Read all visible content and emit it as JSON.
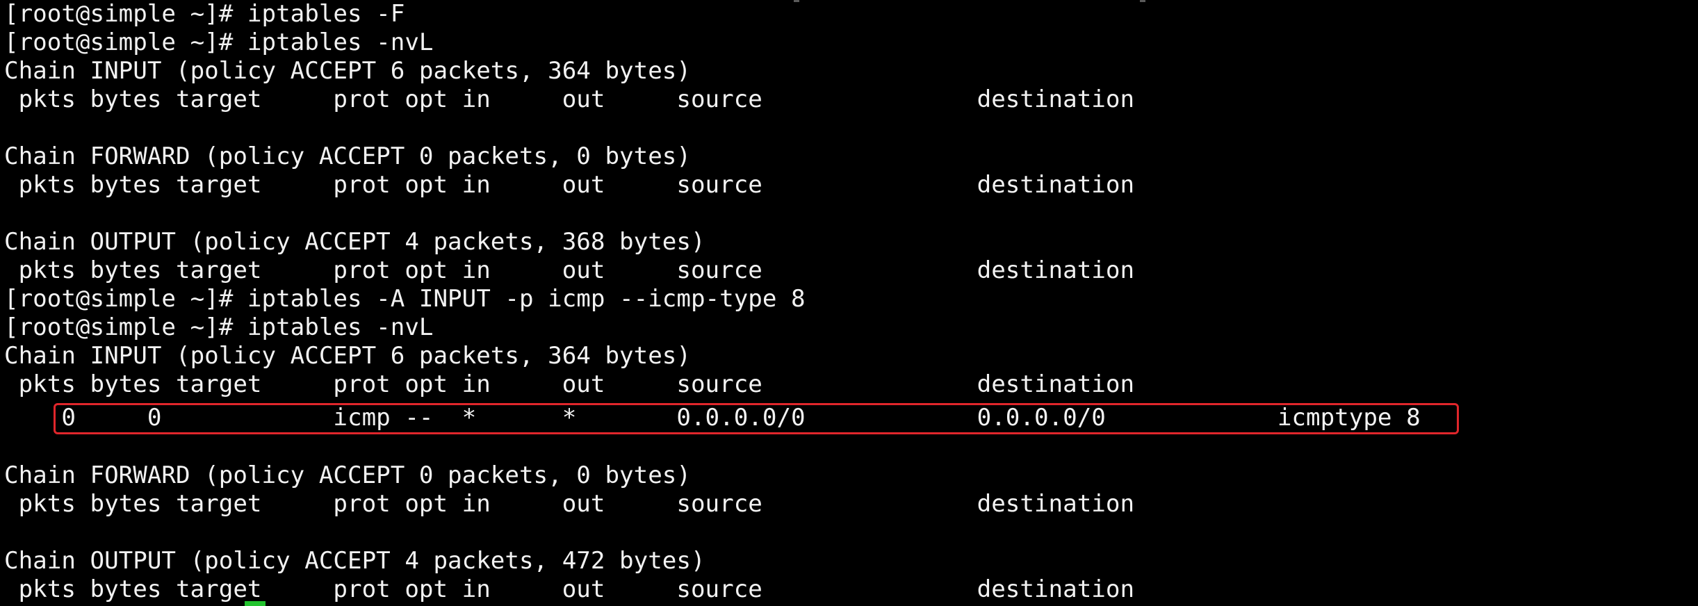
{
  "terminal": {
    "background": "#000000",
    "text_color": "#f2f2f2",
    "highlight_color": "#e0262b",
    "cursor_color": "#22c32e",
    "lines": [
      "[root@simple ~]# iptables -F",
      "[root@simple ~]# iptables -nvL",
      "Chain INPUT (policy ACCEPT 6 packets, 364 bytes)",
      " pkts bytes target     prot opt in     out     source               destination",
      "",
      "Chain FORWARD (policy ACCEPT 0 packets, 0 bytes)",
      " pkts bytes target     prot opt in     out     source               destination",
      "",
      "Chain OUTPUT (policy ACCEPT 4 packets, 368 bytes)",
      " pkts bytes target     prot opt in     out     source               destination",
      "[root@simple ~]# iptables -A INPUT -p icmp --icmp-type 8",
      "[root@simple ~]# iptables -nvL",
      "Chain INPUT (policy ACCEPT 6 packets, 364 bytes)",
      " pkts bytes target     prot opt in     out     source               destination",
      "    0     0            icmp --  *      *       0.0.0.0/0            0.0.0.0/0            icmptype 8",
      "",
      "Chain FORWARD (policy ACCEPT 0 packets, 0 bytes)",
      " pkts bytes target     prot opt in     out     source               destination",
      "",
      "Chain OUTPUT (policy ACCEPT 4 packets, 472 bytes)",
      " pkts bytes target     prot opt in     out     source               destination"
    ]
  }
}
